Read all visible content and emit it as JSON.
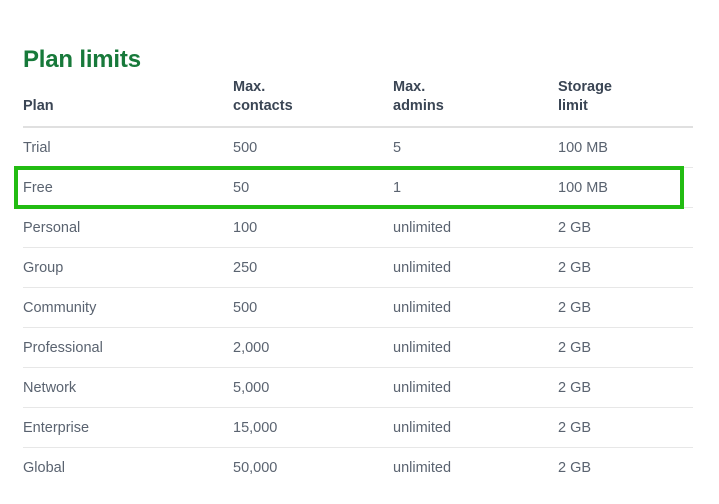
{
  "page": {
    "title": "Plan limits"
  },
  "table": {
    "name": "plan-limits-table",
    "columns": [
      {
        "key": "plan",
        "label": "Plan"
      },
      {
        "key": "contacts",
        "label": "Max.\ncontacts"
      },
      {
        "key": "admins",
        "label": "Max.\nadmins"
      },
      {
        "key": "storage",
        "label": "Storage\nlimit"
      }
    ],
    "rows": [
      {
        "plan": "Trial",
        "contacts": "500",
        "admins": "5",
        "storage": "100 MB",
        "highlighted": false
      },
      {
        "plan": "Free",
        "contacts": "50",
        "admins": "1",
        "storage": "100 MB",
        "highlighted": true
      },
      {
        "plan": "Personal",
        "contacts": "100",
        "admins": "unlimited",
        "storage": "2 GB",
        "highlighted": false
      },
      {
        "plan": "Group",
        "contacts": "250",
        "admins": "unlimited",
        "storage": "2 GB",
        "highlighted": false
      },
      {
        "plan": "Community",
        "contacts": "500",
        "admins": "unlimited",
        "storage": "2 GB",
        "highlighted": false
      },
      {
        "plan": "Professional",
        "contacts": "2,000",
        "admins": "unlimited",
        "storage": "2 GB",
        "highlighted": false
      },
      {
        "plan": "Network",
        "contacts": "5,000",
        "admins": "unlimited",
        "storage": "2 GB",
        "highlighted": false
      },
      {
        "plan": "Enterprise",
        "contacts": "15,000",
        "admins": "unlimited",
        "storage": "2 GB",
        "highlighted": false
      },
      {
        "plan": "Global",
        "contacts": "50,000",
        "admins": "unlimited",
        "storage": "2 GB",
        "highlighted": false
      }
    ]
  },
  "colors": {
    "title_green": "#17793a",
    "highlight_green": "#22bc12",
    "header_text": "#3a4554",
    "body_text": "#5a6370",
    "divider": "#e7e7e7",
    "background": "#ffffff"
  }
}
